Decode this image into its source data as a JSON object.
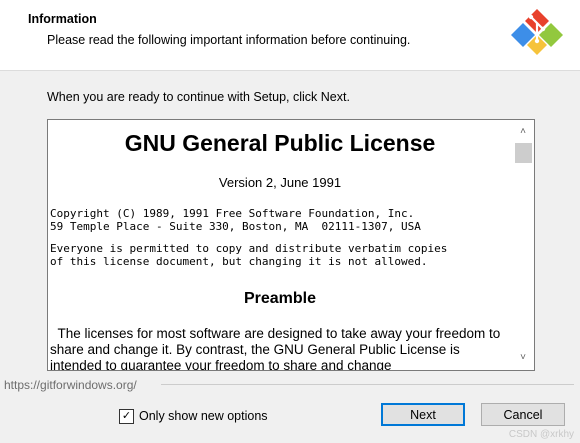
{
  "header": {
    "title": "Information",
    "subtitle": "Please read the following important information before continuing."
  },
  "intro_text": "When you are ready to continue with Setup, click Next.",
  "license": {
    "title": "GNU General Public License",
    "version": "Version 2, June 1991",
    "copyright_line1": "Copyright (C) 1989, 1991 Free Software Foundation, Inc.",
    "copyright_line2": "59 Temple Place - Suite 330, Boston, MA  02111-1307, USA",
    "everyone_line1": "Everyone is permitted to copy and distribute verbatim copies",
    "everyone_line2": "of this license document, but changing it is not allowed.",
    "preamble_heading": "Preamble",
    "preamble_text": "  The licenses for most software are designed to take away your freedom to share and change it. By contrast, the GNU General Public License is intended to guarantee your freedom to share and change"
  },
  "scrollbar": {
    "up_glyph": "˄",
    "down_glyph": "˅"
  },
  "footer": {
    "url": "https://gitforwindows.org/",
    "checkbox_label": "Only show new options",
    "checkbox_checked": true,
    "checkbox_glyph": "✓",
    "next_label": "Next",
    "cancel_label": "Cancel"
  },
  "watermark": "CSDN @xrkhy",
  "colors": {
    "accent": "#0078d7",
    "logo_red": "#e8412c",
    "logo_blue": "#3d8ee8",
    "logo_green": "#92c83e",
    "logo_yellow": "#f6c33b"
  }
}
